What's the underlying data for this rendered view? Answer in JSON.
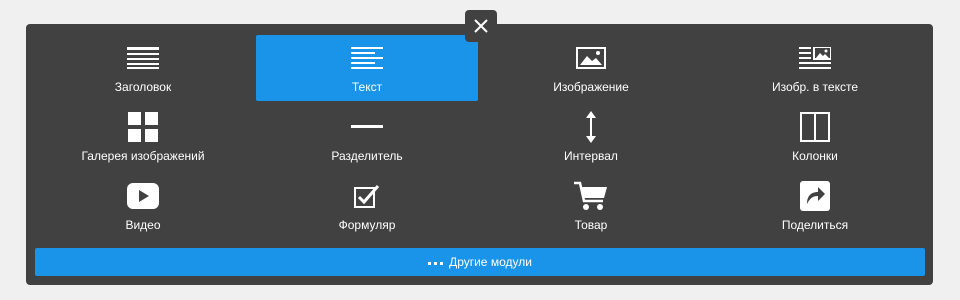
{
  "close": {
    "icon": "close-icon"
  },
  "modules": [
    {
      "id": "heading",
      "label": "Заголовок",
      "icon": "heading-lines-icon",
      "active": false
    },
    {
      "id": "text",
      "label": "Текст",
      "icon": "text-lines-icon",
      "active": true
    },
    {
      "id": "image",
      "label": "Изображение",
      "icon": "image-icon",
      "active": false
    },
    {
      "id": "image-in-text",
      "label": "Изобр. в тексте",
      "icon": "image-text-icon",
      "active": false
    },
    {
      "id": "gallery",
      "label": "Галерея изображений",
      "icon": "gallery-grid-icon",
      "active": false
    },
    {
      "id": "divider",
      "label": "Разделитель",
      "icon": "divider-line-icon",
      "active": false
    },
    {
      "id": "spacing",
      "label": "Интервал",
      "icon": "vertical-arrows-icon",
      "active": false
    },
    {
      "id": "columns",
      "label": "Колонки",
      "icon": "columns-icon",
      "active": false
    },
    {
      "id": "video",
      "label": "Видео",
      "icon": "play-icon",
      "active": false
    },
    {
      "id": "form",
      "label": "Формуляр",
      "icon": "checkbox-icon",
      "active": false
    },
    {
      "id": "product",
      "label": "Товар",
      "icon": "cart-icon",
      "active": false
    },
    {
      "id": "share",
      "label": "Поделиться",
      "icon": "share-arrow-icon",
      "active": false
    }
  ],
  "more": {
    "label": "Другие модули",
    "icon": "dots-icon"
  },
  "colors": {
    "panel": "#414141",
    "accent": "#1a94e8",
    "text": "#ffffff"
  }
}
